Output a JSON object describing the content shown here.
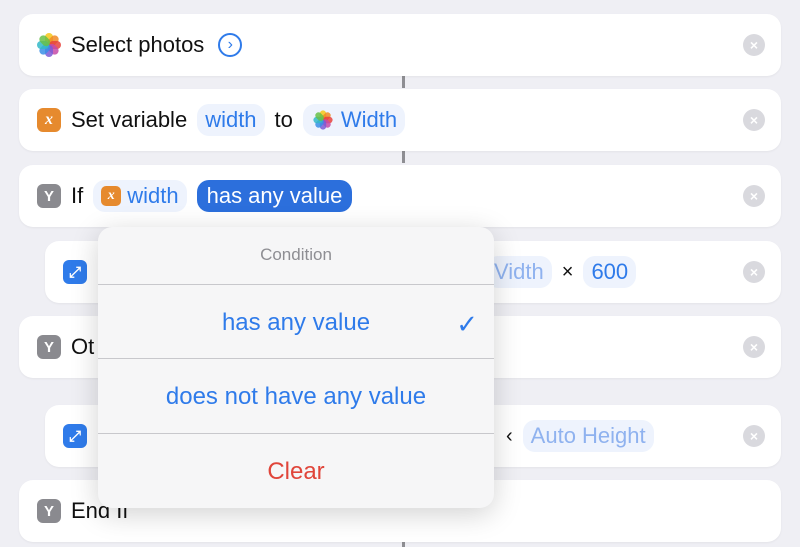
{
  "steps": {
    "select_photos": {
      "label": "Select photos"
    },
    "set_variable": {
      "label": "Set variable",
      "var_name": "width",
      "to": "to",
      "value": "Width"
    },
    "if": {
      "label": "If",
      "var_name": "width",
      "condition": "has any value"
    },
    "resize1": {
      "value_partial": "Vidth",
      "times": "×",
      "number": "600"
    },
    "otherwise": {
      "label_partial": "Ot"
    },
    "resize2": {
      "times_partial": "‹",
      "value": "Auto Height"
    },
    "end_if": {
      "label": "End If"
    }
  },
  "popover": {
    "title": "Condition",
    "options": [
      "has any value",
      "does not have any value"
    ],
    "selected": "has any value",
    "clear_label": "Clear",
    "checkmark": "✓"
  },
  "glyphs": {
    "remove": "×",
    "chevron": "›",
    "variable": "x",
    "if": "Y",
    "resize": "⤢"
  },
  "colors": {
    "accent": "#2f7bea",
    "destructive": "#e0453a",
    "variable_icon": "#e68a2e"
  }
}
